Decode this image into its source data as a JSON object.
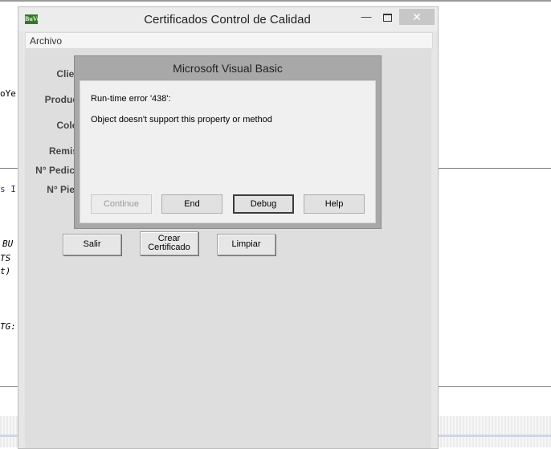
{
  "background_editor": {
    "code_lines": [
      "oYe",
      "s I",
      "BU",
      "TS",
      "t)",
      "TG:"
    ]
  },
  "window": {
    "title": "Certificados Control de Calidad",
    "app_icon_text": "BuVo",
    "minimize_symbol": "—",
    "close_symbol": "✕",
    "menu": [
      "Archivo"
    ]
  },
  "form": {
    "labels": {
      "cliente": "Clier",
      "producto": "Produc",
      "color": "Colo",
      "remision": "Remis",
      "pedido": "N° Pedic",
      "pieza": "N° Pie"
    },
    "buttons": {
      "salir": "Salir",
      "crear_line1": "Crear",
      "crear_line2": "Certificado",
      "limpiar": "Limpiar"
    }
  },
  "dialog": {
    "title": "Microsoft Visual Basic",
    "error_line": "Run-time error '438':",
    "message": "Object doesn't support this property or method",
    "buttons": {
      "continue": "Continue",
      "end": "End",
      "debug": "Debug",
      "help": "Help"
    }
  }
}
